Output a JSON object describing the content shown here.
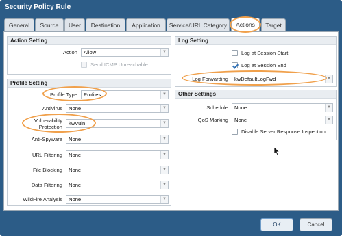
{
  "window": {
    "title": "Security Policy Rule"
  },
  "tabs": [
    {
      "label": "General"
    },
    {
      "label": "Source"
    },
    {
      "label": "User"
    },
    {
      "label": "Destination"
    },
    {
      "label": "Application"
    },
    {
      "label": "Service/URL Category"
    },
    {
      "label": "Actions",
      "active": true
    },
    {
      "label": "Target"
    }
  ],
  "action_setting": {
    "title": "Action Setting",
    "action_label": "Action",
    "action_value": "Allow",
    "send_icmp_label": "Send ICMP Unreachable"
  },
  "profile_setting": {
    "title": "Profile Setting",
    "profile_type_label": "Profile Type",
    "profile_type_value": "Profiles",
    "antivirus_label": "Antivirus",
    "antivirus_value": "None",
    "vuln_label_line1": "Vulnerability",
    "vuln_label_line2": "Protection",
    "vuln_value": "kwVuln",
    "antispyware_label": "Anti-Spyware",
    "antispyware_value": "None",
    "url_label": "URL Filtering",
    "url_value": "None",
    "file_label": "File Blocking",
    "file_value": "None",
    "data_label": "Data Filtering",
    "data_value": "None",
    "wildfire_label": "WildFire Analysis",
    "wildfire_value": "None"
  },
  "log_setting": {
    "title": "Log Setting",
    "log_start_label": "Log at Session Start",
    "log_start_checked": false,
    "log_end_label": "Log at Session End",
    "log_end_checked": true,
    "log_forwarding_label": "Log Forwarding",
    "log_forwarding_value": "kwDefaultLogFwd"
  },
  "other_settings": {
    "title": "Other Settings",
    "schedule_label": "Schedule",
    "schedule_value": "None",
    "qos_label": "QoS Marking",
    "qos_value": "None",
    "disable_sri_label": "Disable Server Response Inspection",
    "disable_sri_checked": false
  },
  "buttons": {
    "ok": "OK",
    "cancel": "Cancel"
  },
  "colors": {
    "dialog_bg": "#2c5c87",
    "highlight": "#f0a04b",
    "check": "#2d6fb5"
  }
}
